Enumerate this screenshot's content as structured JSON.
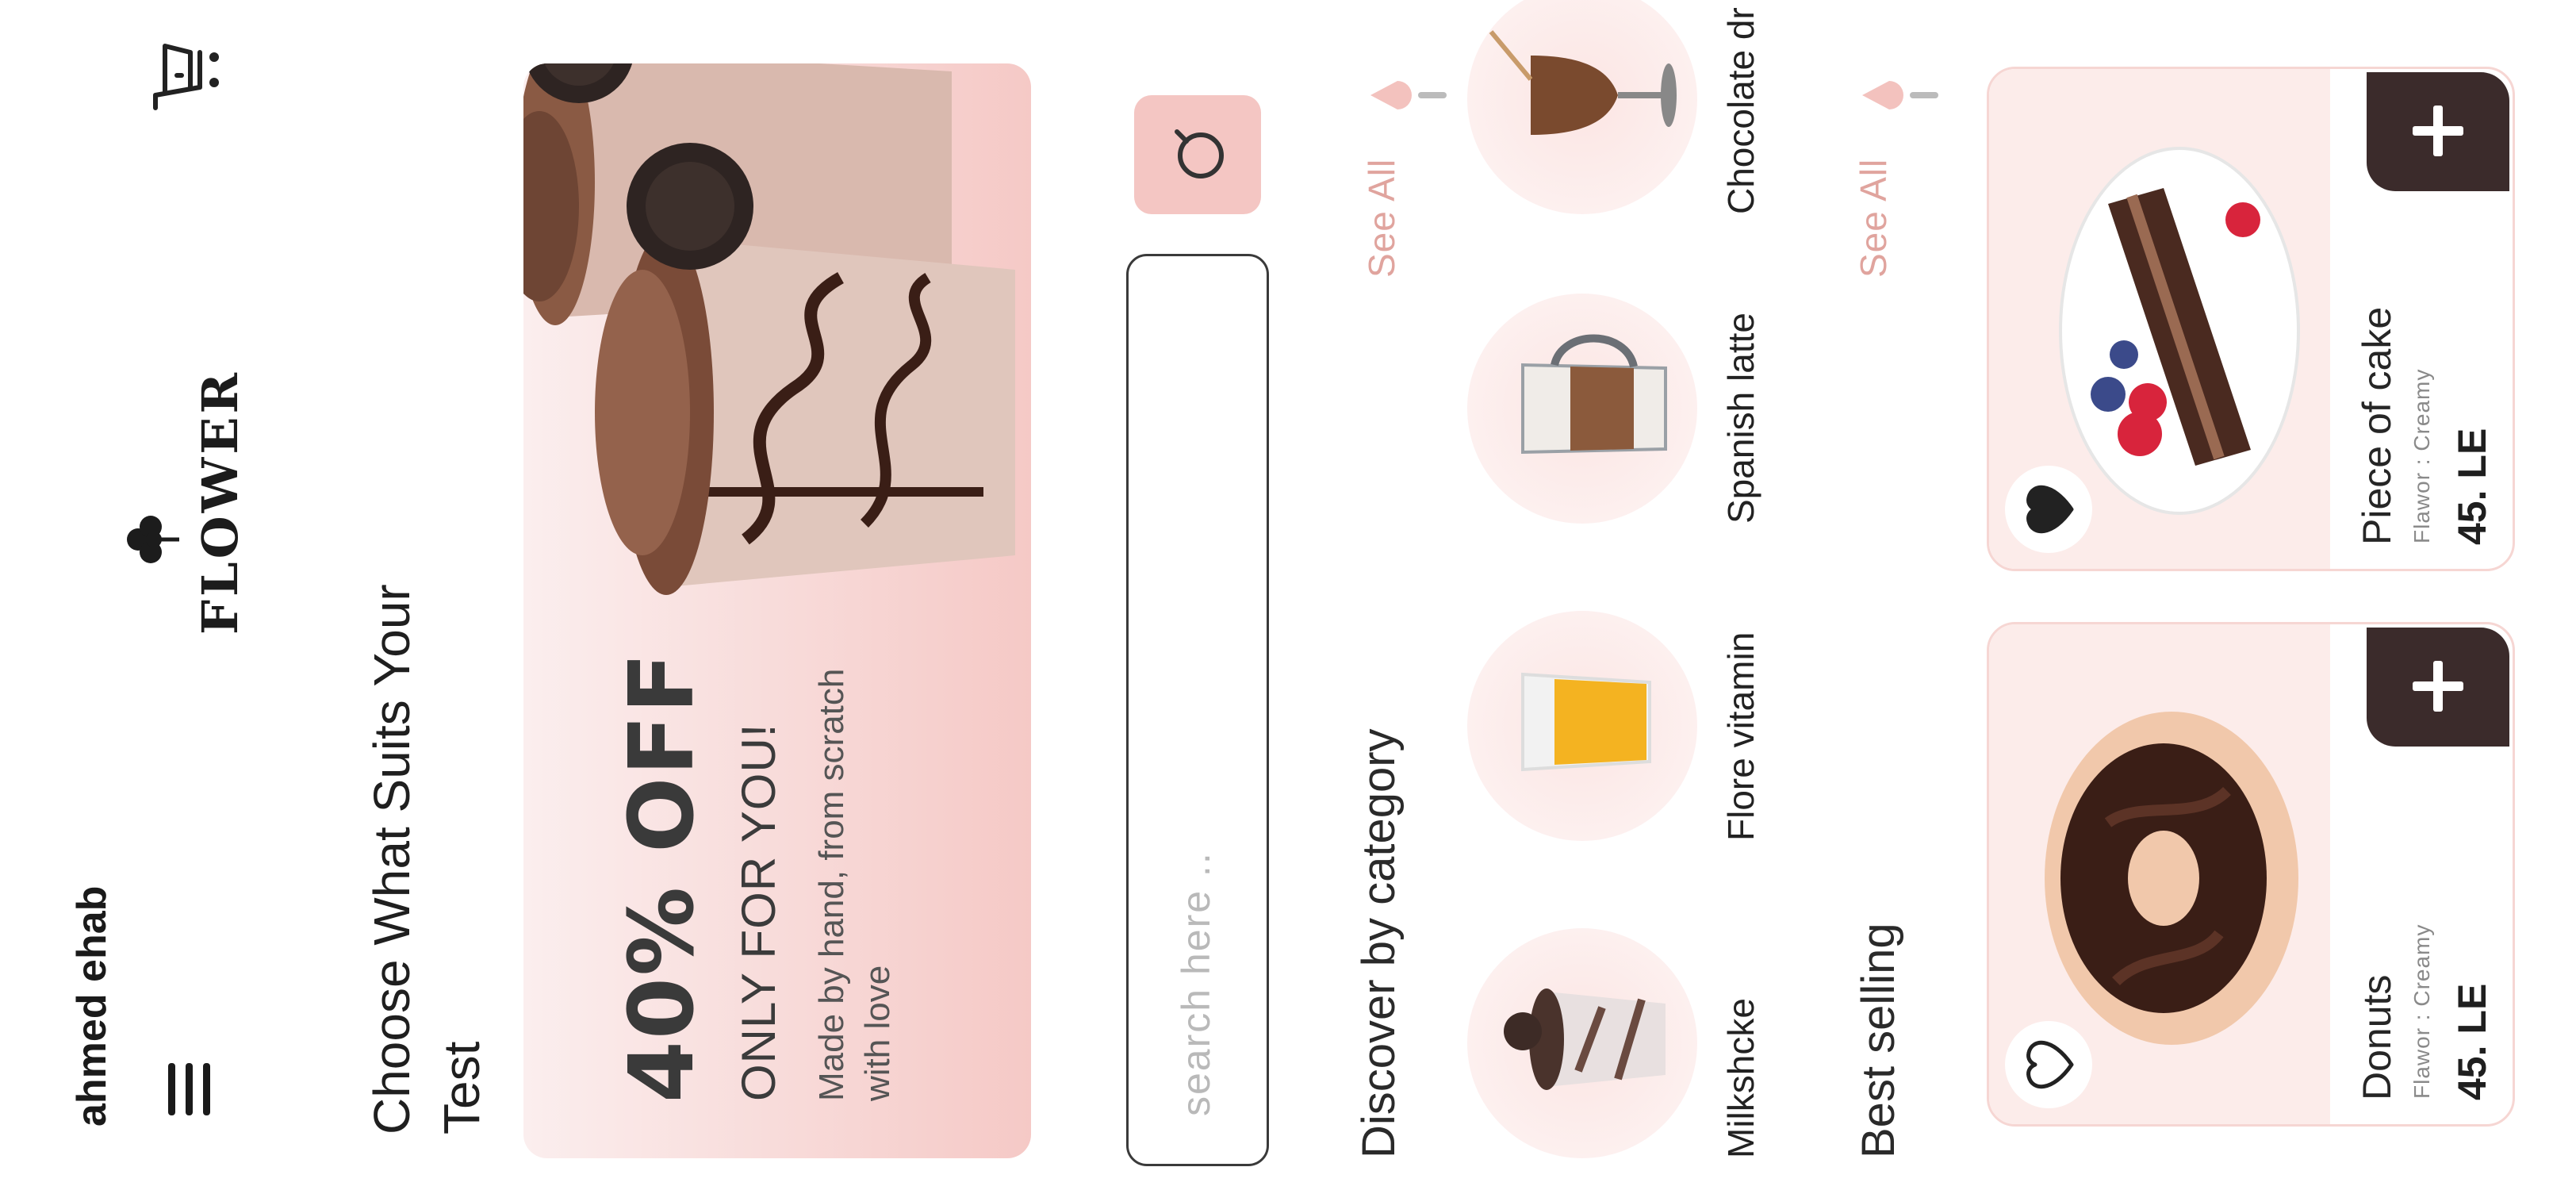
{
  "user": {
    "name": "ahmed ehab"
  },
  "brand": {
    "name": "FLOWER"
  },
  "header": {
    "headline": "Choose What Suits Your Test"
  },
  "promo": {
    "discount": "40% OFF",
    "subtitle": "ONLY FOR YOU!",
    "description": "Made by hand, from scratch with love"
  },
  "search": {
    "placeholder": "search here .."
  },
  "categories": {
    "title": "Discover by category",
    "see_all": "See All",
    "items": [
      {
        "label": "Milkshcke",
        "icon": "milkshake"
      },
      {
        "label": "Flore vitamin",
        "icon": "orange-juice"
      },
      {
        "label": "Spanish latte",
        "icon": "latte"
      },
      {
        "label": "Chocolate dr",
        "icon": "chocolate-drink"
      }
    ]
  },
  "best_selling": {
    "title": "Best selling",
    "see_all": "See All",
    "products": [
      {
        "name": "Donuts",
        "flavor": "Flawor : Creamy",
        "price": "45. LE",
        "favorited": false
      },
      {
        "name": "Piece of cake",
        "flavor": "Flawor : Creamy",
        "price": "45. LE",
        "favorited": true
      }
    ]
  },
  "colors": {
    "accent_pink": "#f4c6c3",
    "see_all_text": "#e0a49e",
    "dark_button": "#3b2b2b",
    "card_bg": "#fcecea"
  }
}
